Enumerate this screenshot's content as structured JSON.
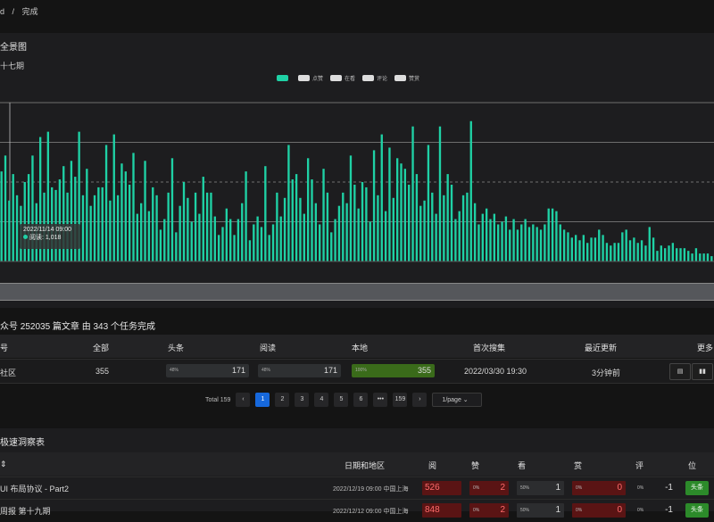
{
  "breadcrumb": [
    "d",
    "/",
    "完成"
  ],
  "chart_panel": {
    "title": "全景图",
    "subtitle": "十七期",
    "legend": [
      {
        "label": "",
        "color": "#1fd1a5"
      },
      {
        "label": "点赞",
        "color": "#dddddd"
      },
      {
        "label": "在看",
        "color": "#dddddd"
      },
      {
        "label": "评论",
        "color": "#dddddd"
      },
      {
        "label": "赞赏",
        "color": "#dddddd"
      }
    ],
    "tooltip": {
      "time": "2022/11/14 09:00",
      "series": "阅读",
      "value": "1,018"
    }
  },
  "chart_data": {
    "type": "bar",
    "series": [
      {
        "name": "阅读",
        "color": "#1fd1a5",
        "values": [
          1700,
          2000,
          1150,
          1650,
          1250,
          1050,
          1500,
          1650,
          2000,
          1100,
          2350,
          1300,
          2450,
          1400,
          1350,
          1550,
          1800,
          1300,
          1900,
          1600,
          2450,
          1250,
          1750,
          1050,
          1250,
          1400,
          1400,
          2200,
          1150,
          2400,
          1250,
          1850,
          1700,
          1450,
          2050,
          900,
          1100,
          1900,
          950,
          1400,
          1250,
          600,
          800,
          1300,
          1950,
          550,
          1050,
          1500,
          1200,
          750,
          1300,
          900,
          1600,
          1300,
          1300,
          850,
          500,
          650,
          1000,
          800,
          500,
          800,
          1100,
          1700,
          400,
          700,
          850,
          650,
          1800,
          500,
          700,
          1300,
          850,
          1200,
          2200,
          1550,
          1650,
          1200,
          900,
          1950,
          1550,
          1100,
          700,
          1750,
          1300,
          550,
          800,
          1050,
          1300,
          1100,
          2000,
          1450,
          1000,
          1500,
          1400,
          750,
          2100,
          1250,
          2400,
          950,
          2150,
          1200,
          1950,
          1850,
          1750,
          1450,
          2550,
          1650,
          1050,
          1150,
          2200,
          1300,
          900,
          2550,
          1250,
          1650,
          1450,
          800,
          950,
          1250,
          1300,
          2650,
          1100,
          700,
          900,
          1000,
          800,
          900,
          700,
          750,
          850,
          600,
          800,
          600,
          700,
          800,
          650,
          700,
          650,
          600,
          700,
          1000,
          1000,
          950,
          700,
          600,
          550,
          450,
          500,
          400,
          500,
          350,
          450,
          450,
          600,
          500,
          350,
          300,
          350,
          350,
          550,
          600,
          400,
          450,
          350,
          400,
          300,
          650,
          450,
          200,
          300,
          250,
          300,
          350,
          250,
          250,
          250,
          200,
          150,
          250,
          150,
          150,
          150,
          100
        ]
      }
    ],
    "ylim": [
      0,
      3000
    ],
    "grid": true
  },
  "summary": "众号 252035 篇文章 由 343 个任务完成",
  "table": {
    "headers": [
      "号",
      "全部",
      "头条",
      "阅读",
      "本地",
      "首次搜集",
      "最近更新",
      "更多"
    ],
    "row": {
      "name": "社区",
      "all": "355",
      "headline": {
        "pct": "48%",
        "value": "171",
        "fraction": 0.48
      },
      "read": {
        "pct": "48%",
        "value": "171",
        "fraction": 0.48
      },
      "local": {
        "pct": "100%",
        "value": "355",
        "fraction": 1.0
      },
      "first": "2022/03/30 19:30",
      "updated": "3分钟前"
    }
  },
  "pagination": {
    "total": "Total 159",
    "pages": [
      "1",
      "2",
      "3",
      "4",
      "5",
      "6",
      "•••",
      "159"
    ],
    "size": "1/page"
  },
  "panel2": {
    "title": "极速洞察表",
    "headers": [
      "",
      "日期和地区",
      "阅",
      "赞",
      "看",
      "赏",
      "评",
      "位"
    ],
    "rows": [
      {
        "title": "UI 布局协议 - Part2",
        "date": "2022/12/19 09:00 中国上海",
        "read": "526",
        "zan": {
          "pct": "0%",
          "v": "2"
        },
        "kan": {
          "pct": "50%",
          "v": "1"
        },
        "shang": {
          "pct": "0%",
          "v": "0"
        },
        "ping": {
          "pct": "0%",
          "v": "-1"
        },
        "tag": "头条"
      },
      {
        "title": "周报 第十九期",
        "date": "2022/12/12 09:00 中国上海",
        "read": "848",
        "zan": {
          "pct": "0%",
          "v": "2"
        },
        "kan": {
          "pct": "50%",
          "v": "1"
        },
        "shang": {
          "pct": "0%",
          "v": "0"
        },
        "ping": {
          "pct": "0%",
          "v": "-1"
        },
        "tag": "头条"
      }
    ]
  }
}
